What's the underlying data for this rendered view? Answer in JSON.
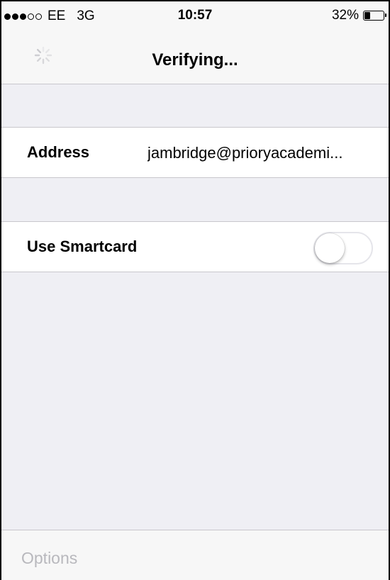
{
  "status_bar": {
    "signal_bars_filled": 3,
    "signal_bars_total": 5,
    "carrier": "EE",
    "network": "3G",
    "time": "10:57",
    "battery_percent_label": "32%",
    "battery_level": 0.32
  },
  "nav": {
    "title": "Verifying...",
    "activity_icon": "spinner-icon"
  },
  "settings": {
    "address": {
      "label": "Address",
      "value": "jambridge@prioryacademi..."
    },
    "smartcard": {
      "label": "Use Smartcard",
      "enabled": false
    }
  },
  "toolbar": {
    "options_label": "Options"
  },
  "colors": {
    "toggle_off_border": "#e5e5ea",
    "disabled_text": "#b8b8bd",
    "separator": "#c8c7cc"
  }
}
